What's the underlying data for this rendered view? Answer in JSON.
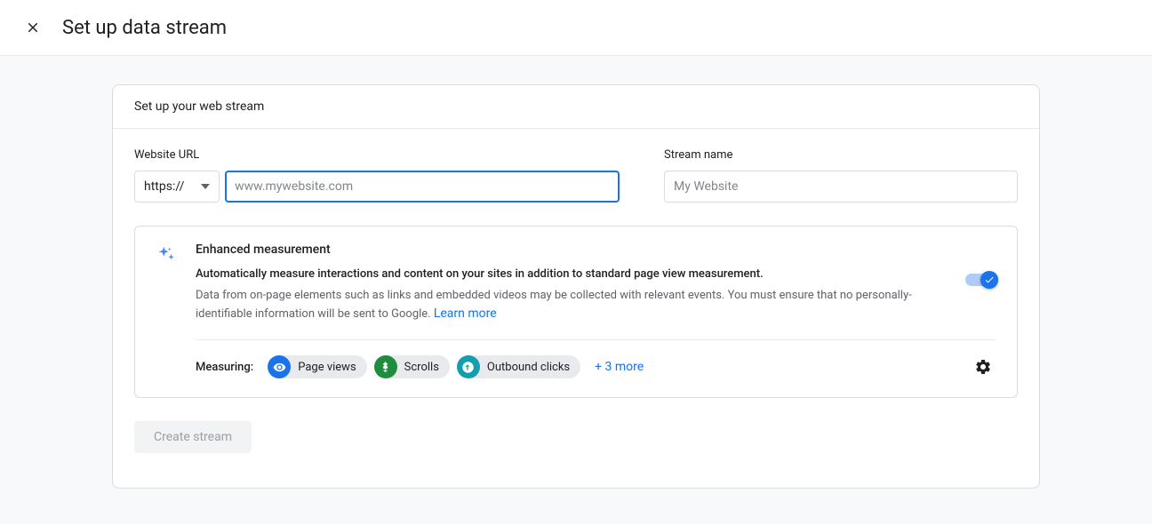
{
  "header": {
    "title": "Set up data stream"
  },
  "card": {
    "header": "Set up your web stream",
    "url_label": "Website URL",
    "protocol_selected": "https://",
    "url_placeholder": "www.mywebsite.com",
    "name_label": "Stream name",
    "name_placeholder": "My Website"
  },
  "enhanced": {
    "title": "Enhanced measurement",
    "subtitle": "Automatically measure interactions and content on your sites in addition to standard page view measurement.",
    "note": "Data from on-page elements such as links and embedded videos may be collected with relevant events. You must ensure that no personally-identifiable information will be sent to Google. ",
    "learn_more": "Learn more",
    "measuring_label": "Measuring:",
    "chips": [
      {
        "label": "Page views",
        "icon": "eye",
        "color": "blue"
      },
      {
        "label": "Scrolls",
        "icon": "scroll",
        "color": "green"
      },
      {
        "label": "Outbound clicks",
        "icon": "outbound",
        "color": "teal"
      }
    ],
    "more_text": "+ 3 more"
  },
  "actions": {
    "create_label": "Create stream"
  }
}
